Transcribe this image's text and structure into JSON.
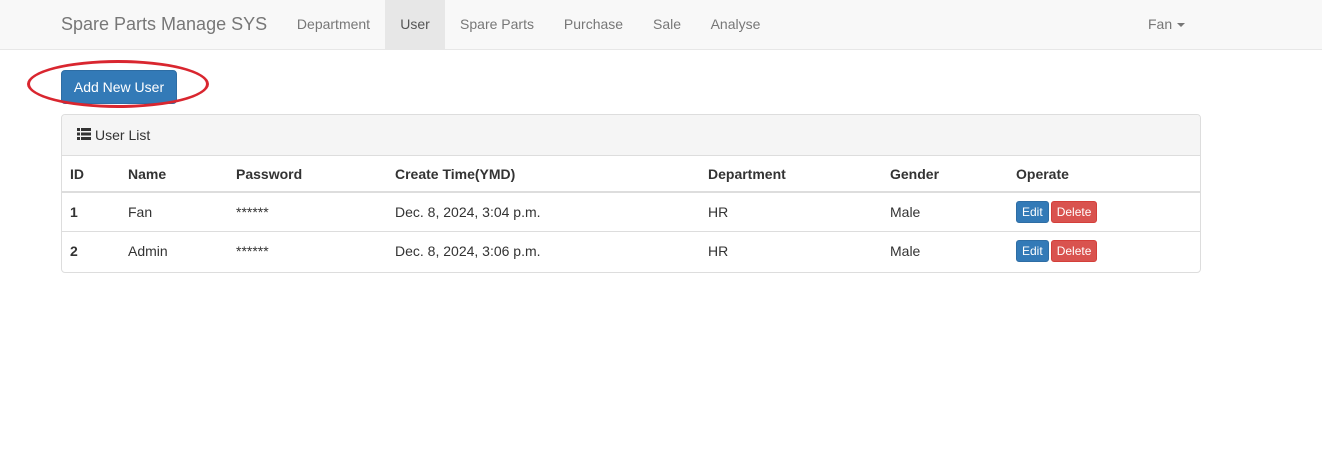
{
  "navbar": {
    "brand": "Spare Parts Manage SYS",
    "items": [
      {
        "label": "Department"
      },
      {
        "label": "User",
        "active": true
      },
      {
        "label": "Spare Parts"
      },
      {
        "label": "Purchase"
      },
      {
        "label": "Sale"
      },
      {
        "label": "Analyse"
      }
    ],
    "user": "Fan"
  },
  "toolbar": {
    "add_label": "Add New User",
    "highlight_color": "#d9262f"
  },
  "panel": {
    "title": "User List",
    "icon": "list-icon"
  },
  "table": {
    "columns": [
      "ID",
      "Name",
      "Password",
      "Create Time(YMD)",
      "Department",
      "Gender",
      "Operate"
    ],
    "rows": [
      {
        "id": "1",
        "name": "Fan",
        "password": "******",
        "create_time": "Dec. 8, 2024, 3:04 p.m.",
        "department": "HR",
        "gender": "Male",
        "edit": "Edit",
        "delete": "Delete"
      },
      {
        "id": "2",
        "name": "Admin",
        "password": "******",
        "create_time": "Dec. 8, 2024, 3:06 p.m.",
        "department": "HR",
        "gender": "Male",
        "edit": "Edit",
        "delete": "Delete"
      }
    ]
  },
  "colors": {
    "primary": "#337ab7",
    "danger": "#d9534f"
  }
}
